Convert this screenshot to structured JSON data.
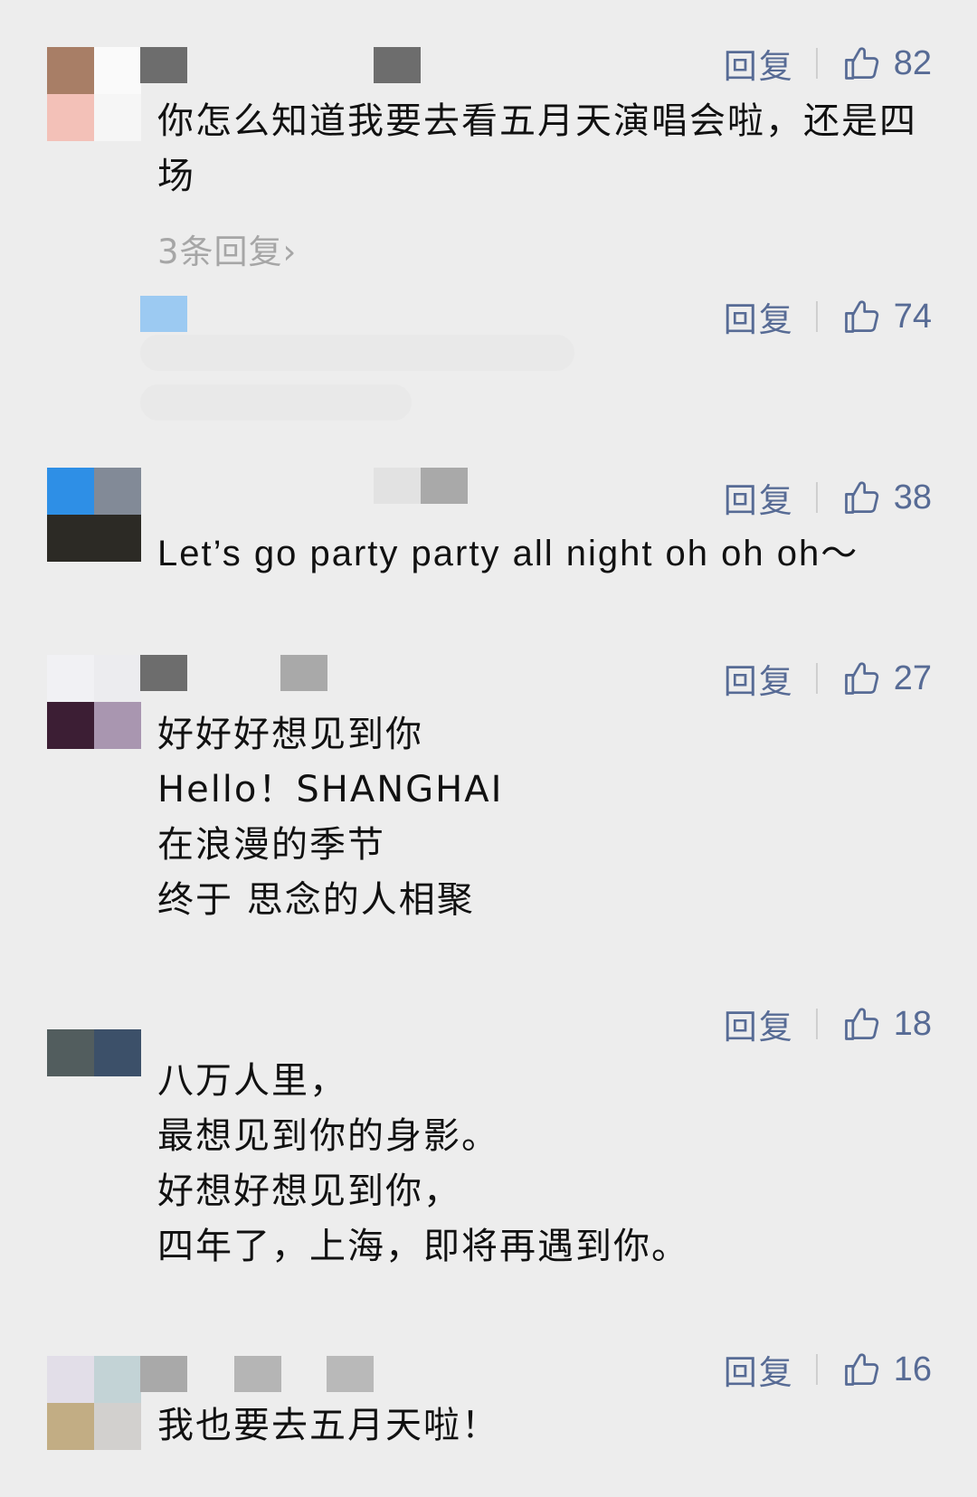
{
  "comments": [
    {
      "text": "你怎么知道我要去看五月天演唱会啦，还是四场",
      "reply_label": "回复",
      "like_count": "82",
      "more_replies": "3条回复›"
    },
    {
      "text": "",
      "reply_label": "回复",
      "like_count": "74"
    },
    {
      "text": "Let’s go party party all night oh oh oh～",
      "reply_label": "回复",
      "like_count": "38"
    },
    {
      "text": "好好好想见到你\nHello！SHANGHAI\n在浪漫的季节\n终于 思念的人相聚",
      "reply_label": "回复",
      "like_count": "27"
    },
    {
      "text": "八万人里，\n最想见到你的身影。\n好想好想见到你，\n四年了，上海，即将再遇到你。",
      "reply_label": "回复",
      "like_count": "18"
    },
    {
      "text": "我也要去五月天啦！",
      "reply_label": "回复",
      "like_count": "16"
    }
  ],
  "colors": {
    "background": "#ededed",
    "link": "#576b95",
    "text": "#111111",
    "secondary": "#a6a6a6"
  },
  "icons": {
    "like": "thumbs-up-icon",
    "more": "chevron-right-icon"
  }
}
